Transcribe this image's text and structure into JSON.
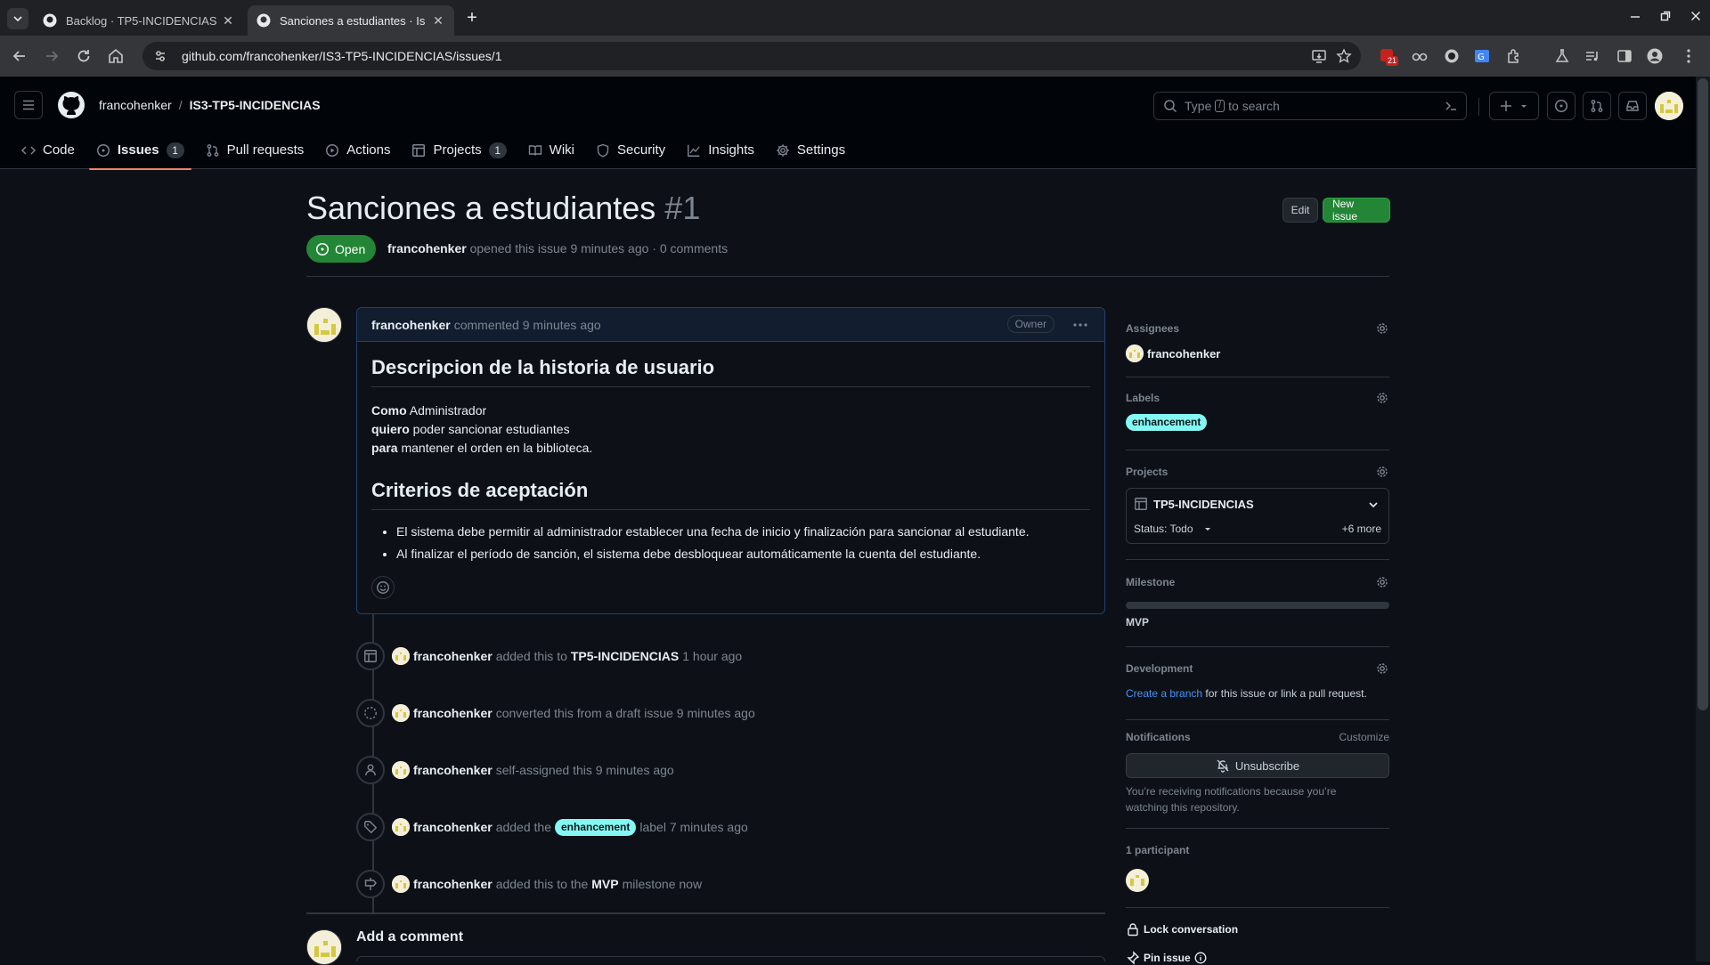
{
  "browser": {
    "tabs": [
      {
        "title": "Backlog · TP5-INCIDENCIAS",
        "active": false
      },
      {
        "title": "Sanciones a estudiantes · Is",
        "active": true
      }
    ],
    "url": "github.com/francohenker/IS3-TP5-INCIDENCIAS/issues/1",
    "extension_badge": "21"
  },
  "header": {
    "owner": "francohenker",
    "separator": "/",
    "repo": "IS3-TP5-INCIDENCIAS",
    "search_placeholder_pre": "Type",
    "search_key": "/",
    "search_placeholder_post": "to search"
  },
  "repo_nav": [
    {
      "label": "Code",
      "icon": "code-icon"
    },
    {
      "label": "Issues",
      "icon": "issue-opened-icon",
      "count": "1",
      "active": true
    },
    {
      "label": "Pull requests",
      "icon": "git-pull-request-icon"
    },
    {
      "label": "Actions",
      "icon": "play-icon"
    },
    {
      "label": "Projects",
      "icon": "table-icon",
      "count": "1"
    },
    {
      "label": "Wiki",
      "icon": "book-icon"
    },
    {
      "label": "Security",
      "icon": "shield-icon"
    },
    {
      "label": "Insights",
      "icon": "graph-icon"
    },
    {
      "label": "Settings",
      "icon": "gear-icon"
    }
  ],
  "issue": {
    "title": "Sanciones a estudiantes",
    "number": "#1",
    "edit_label": "Edit",
    "new_issue_label": "New issue",
    "state": "Open",
    "author": "francohenker",
    "meta_text": "opened this issue 9 minutes ago · 0 comments"
  },
  "comment": {
    "author": "francohenker",
    "action": "commented 9 minutes ago",
    "role": "Owner",
    "heading1": "Descripcion de la historia de usuario",
    "lines": [
      {
        "bold": "Como",
        "text": "Administrador"
      },
      {
        "bold": "quiero",
        "text": "poder sancionar estudiantes"
      },
      {
        "bold": "para",
        "text": "mantener el orden en la biblioteca."
      }
    ],
    "heading2": "Criterios de aceptación",
    "criteria": [
      "El sistema debe permitir al administrador establecer una fecha de inicio y finalización para sancionar al estudiante.",
      "Al finalizar el período de sanción, el sistema debe desbloquear automáticamente la cuenta del estudiante."
    ]
  },
  "timeline": [
    {
      "icon": "table-icon",
      "user": "francohenker",
      "pre": "added this to",
      "strong": "TP5-INCIDENCIAS",
      "post": "1 hour ago"
    },
    {
      "icon": "issue-draft-icon",
      "user": "francohenker",
      "pre": "converted this from a draft issue 9 minutes ago",
      "strong": "",
      "post": ""
    },
    {
      "icon": "person-icon",
      "user": "francohenker",
      "pre": "self-assigned this 9 minutes ago",
      "strong": "",
      "post": ""
    },
    {
      "icon": "tag-icon",
      "user": "francohenker",
      "pre": "added the",
      "label": "enhancement",
      "post": "label 7 minutes ago"
    },
    {
      "icon": "milestone-icon",
      "user": "francohenker",
      "pre": "added this to the",
      "strong": "MVP",
      "post": "milestone now"
    }
  ],
  "add_comment": "Add a comment",
  "sidebar": {
    "assignees_title": "Assignees",
    "assignee": "francohenker",
    "labels_title": "Labels",
    "label": "enhancement",
    "label_color": "#84f7f3",
    "projects_title": "Projects",
    "project_name": "TP5-INCIDENCIAS",
    "project_status": "Status: Todo",
    "project_more": "+6 more",
    "milestone_title": "Milestone",
    "milestone_name": "MVP",
    "milestone_progress": 0,
    "development_title": "Development",
    "dev_link": "Create a branch",
    "dev_text": "for this issue or link a pull request.",
    "notifications_title": "Notifications",
    "customize": "Customize",
    "unsubscribe": "Unsubscribe",
    "notif_reason": "You’re receiving notifications because you’re watching this repository.",
    "participants_title": "1 participant",
    "lock": "Lock conversation",
    "pin": "Pin issue"
  }
}
